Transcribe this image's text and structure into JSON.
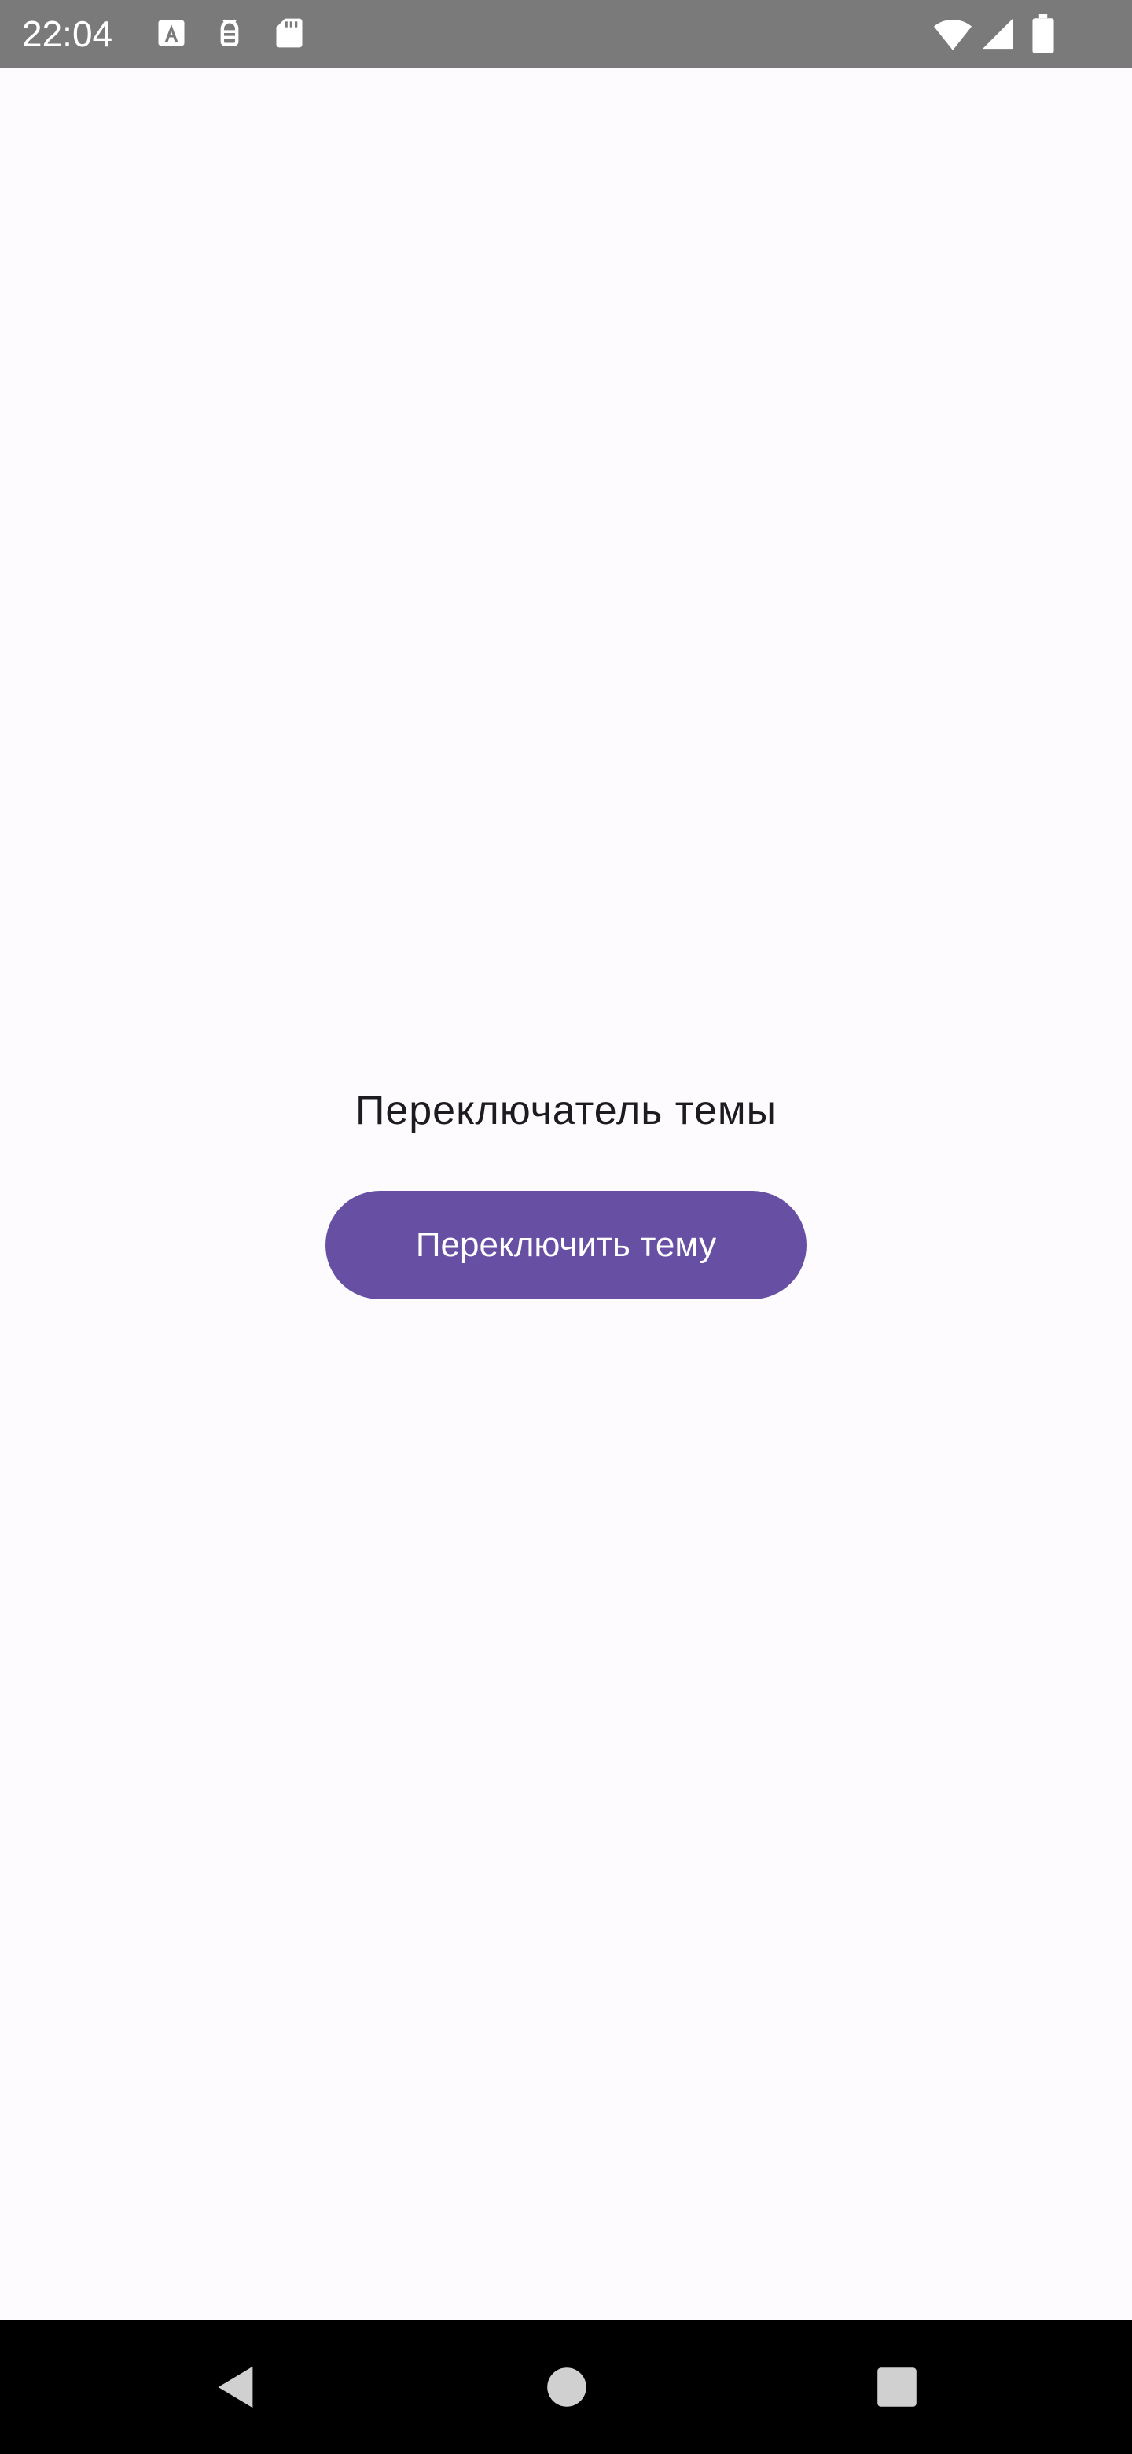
{
  "status_bar": {
    "time": "22:04",
    "icons": [
      "font-a-icon",
      "android-debug-icon",
      "sd-card-icon",
      "wifi-icon",
      "signal-icon",
      "battery-icon"
    ]
  },
  "main": {
    "heading": "Переключатель темы",
    "toggle_button_label": "Переключить тему"
  },
  "nav_bar": {
    "buttons": [
      "back-icon",
      "home-icon",
      "recents-icon"
    ]
  },
  "colors": {
    "background": "#fdfbfe",
    "accent": "#6750a4",
    "status_bar": "#7a7a7a",
    "nav_bar": "#000000"
  }
}
